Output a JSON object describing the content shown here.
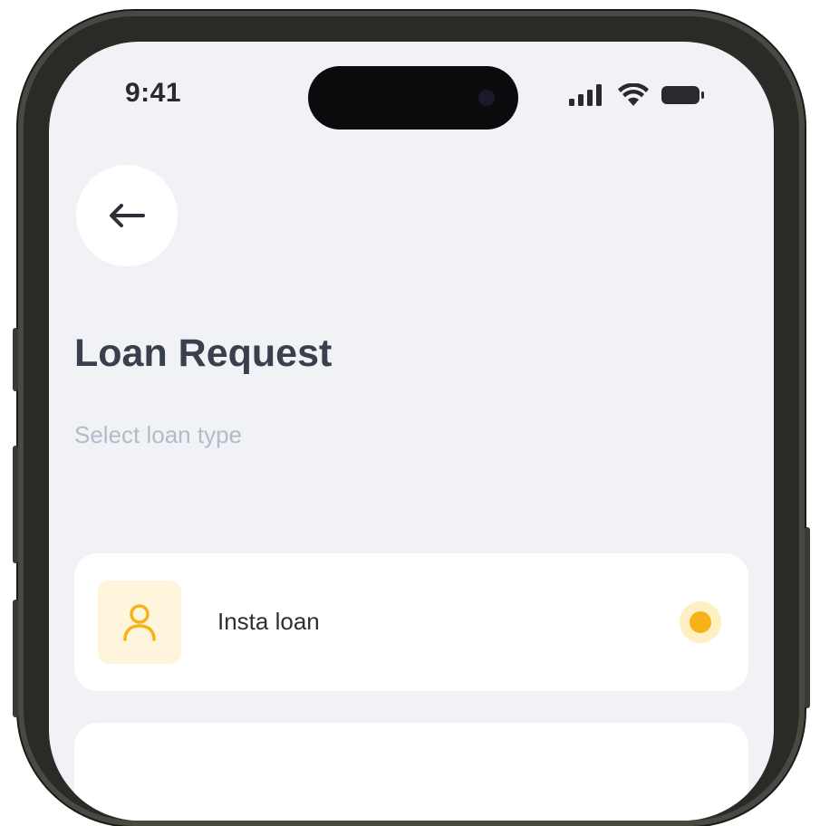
{
  "status_bar": {
    "time": "9:41",
    "icons": [
      "cellular-signal-icon",
      "wifi-icon",
      "battery-icon"
    ]
  },
  "header": {
    "back_icon": "arrow-left-icon",
    "title": "Loan Request",
    "subtitle": "Select loan type"
  },
  "loan_options": [
    {
      "label": "Insta loan",
      "icon": "person-icon",
      "selected": true
    }
  ],
  "colors": {
    "background": "#f1f2f6",
    "accent": "#f7b21a",
    "accent_light": "#fff4dc",
    "title": "#3a3f4e",
    "subtitle": "#b3bac8"
  }
}
